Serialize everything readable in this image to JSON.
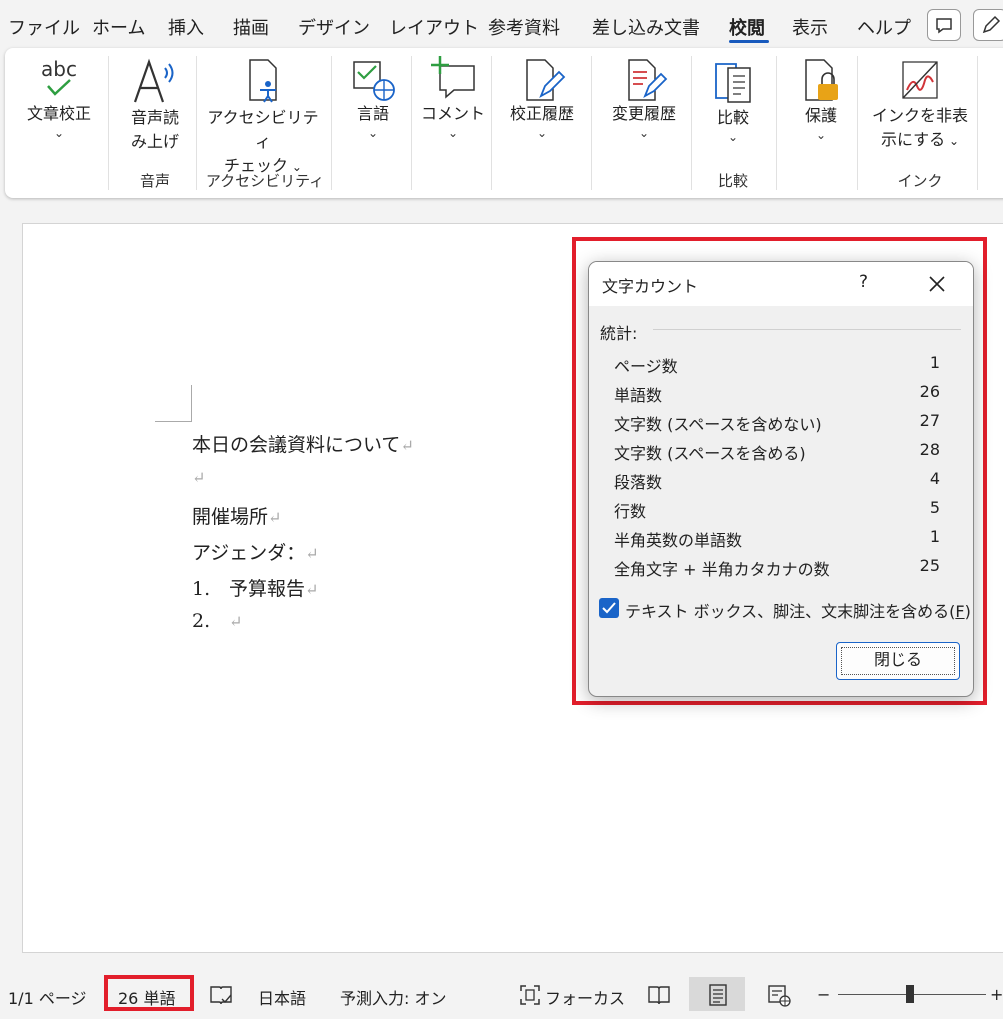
{
  "tabs": [
    {
      "label": "ファイル",
      "active": false
    },
    {
      "label": "ホーム",
      "active": false
    },
    {
      "label": "挿入",
      "active": false
    },
    {
      "label": "描画",
      "active": false
    },
    {
      "label": "デザイン",
      "active": false
    },
    {
      "label": "レイアウト",
      "active": false
    },
    {
      "label": "参考資料",
      "active": false
    },
    {
      "label": "差し込み文書",
      "active": false
    },
    {
      "label": "校閲",
      "active": true
    },
    {
      "label": "表示",
      "active": false
    },
    {
      "label": "ヘルプ",
      "active": false
    }
  ],
  "ribbon": {
    "spelling": {
      "label1": "文章校正",
      "icon_text": "abc"
    },
    "read_aloud": {
      "label1": "音声読",
      "label2": "み上げ"
    },
    "accessibility": {
      "label1": "アクセシビリティ",
      "label2": "チェック"
    },
    "language": {
      "label1": "言語"
    },
    "comment": {
      "label1": "コメント"
    },
    "tracking": {
      "label1": "校正履歴"
    },
    "changes": {
      "label1": "変更履歴"
    },
    "compare": {
      "label1": "比較"
    },
    "protect": {
      "label1": "保護"
    },
    "ink": {
      "label1": "インクを非表",
      "label2": "示にする"
    },
    "groups": {
      "speech": "音声",
      "accessibility": "アクセシビリティ",
      "compare": "比較",
      "ink": "インク"
    }
  },
  "document": {
    "lines": [
      {
        "text": "本日の会議資料について"
      },
      {
        "text": ""
      },
      {
        "text": "開催場所"
      },
      {
        "text": "アジェンダ："
      },
      {
        "num": "1.",
        "text": "予算報告"
      },
      {
        "num": "2.",
        "text": ""
      }
    ],
    "paragraph_mark": "↵"
  },
  "dialog": {
    "title": "文字カウント",
    "help": "?",
    "stats_label": "統計:",
    "stats": [
      {
        "label": "ページ数",
        "value": "1"
      },
      {
        "label": "単語数",
        "value": "26"
      },
      {
        "label": "文字数 (スペースを含めない)",
        "value": "27"
      },
      {
        "label": "文字数 (スペースを含める)",
        "value": "28"
      },
      {
        "label": "段落数",
        "value": "4"
      },
      {
        "label": "行数",
        "value": "5"
      },
      {
        "label": "半角英数の単語数",
        "value": "1"
      },
      {
        "label": "全角文字 + 半角カタカナの数",
        "value": "25"
      }
    ],
    "checkbox": {
      "label_before": "テキスト ボックス、脚注、文末脚注を含める(",
      "accesskey": "F",
      "label_after": ")",
      "checked": true
    },
    "close_button": "閉じる"
  },
  "status": {
    "page": "1/1 ページ",
    "words": "26 単語",
    "language": "日本語",
    "predictive": "予測入力: オン",
    "focus": "フォーカス",
    "zoom_minus": "−",
    "zoom_plus": "+"
  },
  "colors": {
    "accent": "#185abd",
    "highlight": "#e21e2b",
    "checkbox": "#1a64c8"
  }
}
